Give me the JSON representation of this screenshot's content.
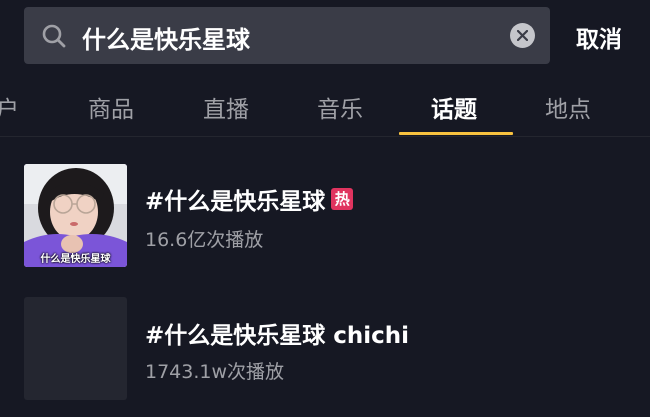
{
  "search": {
    "query": "什么是快乐星球",
    "cancel_label": "取消"
  },
  "tabs": [
    {
      "label": "户",
      "active": false
    },
    {
      "label": "商品",
      "active": false
    },
    {
      "label": "直播",
      "active": false
    },
    {
      "label": "音乐",
      "active": false
    },
    {
      "label": "话题",
      "active": true
    },
    {
      "label": "地点",
      "active": false
    }
  ],
  "results": [
    {
      "title": "#什么是快乐星球",
      "badge": "热",
      "count": "16.6亿次播放",
      "thumb_caption": "什么是快乐星球"
    },
    {
      "title": "#什么是快乐星球 chichi",
      "count": "1743.1w次播放"
    }
  ],
  "colors": {
    "background": "#161823",
    "search_bg": "#3a3c47",
    "accent_indicator": "#f8c23f",
    "hot_badge": "#e0345f",
    "muted_text": "#9fa0a6"
  }
}
